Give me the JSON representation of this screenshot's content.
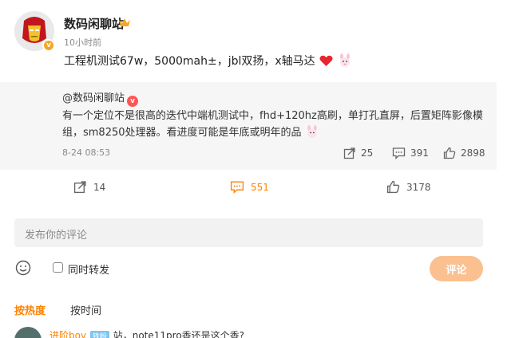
{
  "post": {
    "author_name": "数码闲聊站",
    "time": "10小时前",
    "text": "工程机测试67w，5000mah±，jbl双扬，x轴马达"
  },
  "repost": {
    "author": "@数码闲聊站",
    "body": "有一个定位不是很高的迭代中端机测试中，fhd+120hz高刷，单打孔直屏，后置矩阵影像模组，sm8250处理器。看进度可能是年底或明年的品",
    "time": "8-24 08:53",
    "shares": "25",
    "comments": "391",
    "likes": "2898"
  },
  "actions": {
    "shares": "14",
    "comments": "551",
    "likes": "3178"
  },
  "compose": {
    "placeholder": "发布你的评论",
    "also_repost": "同时转发",
    "submit": "评论"
  },
  "sort": {
    "hot": "按热度",
    "time": "按时间"
  },
  "first_comment": {
    "user": "进阶boy",
    "tag": "铁粉",
    "text": "站，note11pro香还是这个香?"
  },
  "colors": {
    "accent": "#ff8200",
    "submit_bg": "#fbc08f",
    "repost_bg": "#f6f6f6"
  },
  "icons": [
    "crown-icon",
    "heart-icon",
    "bunny-icon",
    "share-icon",
    "comment-icon",
    "like-icon",
    "emoji-icon"
  ]
}
